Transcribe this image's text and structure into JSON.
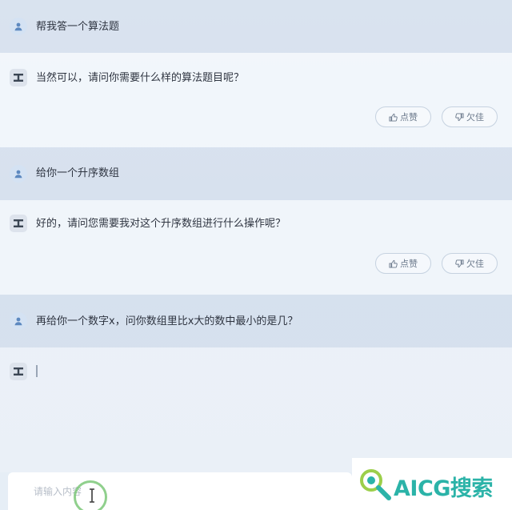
{
  "messages": [
    {
      "role": "user",
      "text": "帮我答一个算法题"
    },
    {
      "role": "assistant",
      "text": "当然可以，请问你需要什么样的算法题目呢？",
      "like_label": "点赞",
      "dislike_label": "欠佳"
    },
    {
      "role": "user",
      "text": "给你一个升序数组"
    },
    {
      "role": "assistant",
      "text": "好的，请问您需要我对这个升序数组进行什么操作呢？",
      "like_label": "点赞",
      "dislike_label": "欠佳"
    },
    {
      "role": "user",
      "text": "再给你一个数字x，问你数组里比x大的数中最小的是几？"
    },
    {
      "role": "assistant",
      "text": ""
    }
  ],
  "input": {
    "placeholder": "请输入内容",
    "value": ""
  },
  "logo": {
    "text": "AICG搜索"
  },
  "colors": {
    "user_row": "#c8d6e8",
    "accent": "#2bb3a8",
    "click_ring": "#74c470"
  }
}
